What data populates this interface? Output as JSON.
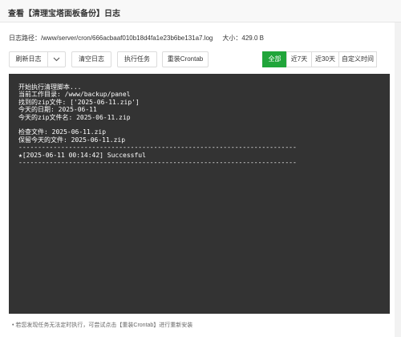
{
  "window": {
    "title": "查看【清理宝塔面板备份】日志"
  },
  "pathline": {
    "label": "日志路径：",
    "path": "/www/server/cron/666acbaaf010b18d4fa1e23b6be131a7.log",
    "size_label": "大小：",
    "size": "429.0 B"
  },
  "toolbar": {
    "refresh_label": "刷新日志",
    "clear_label": "清空日志",
    "run_label": "执行任务",
    "reinstall_label": "重装Crontab",
    "filters": [
      {
        "label": "全部",
        "active": true
      },
      {
        "label": "近7天",
        "active": false
      },
      {
        "label": "近30天",
        "active": false
      },
      {
        "label": "自定义时间",
        "active": false
      }
    ]
  },
  "log_lines": [
    "开始执行清理脚本...",
    "当前工作目录: /www/backup/panel",
    "找到的zip文件: ['2025-06-11.zip']",
    "今天的日期: 2025-06-11",
    "今天的zip文件名: 2025-06-11.zip",
    "",
    "检查文件: 2025-06-11.zip",
    "保留今天的文件: 2025-06-11.zip",
    "------------------------------------------------------------------------",
    "★[2025-06-11 00:14:42] Successful",
    "------------------------------------------------------------------------"
  ],
  "footnote": "•  若您发现任务无法定时执行，可尝试点击【重装Crontab】进行重新安装",
  "colors": {
    "accent": "#20a53a",
    "terminal_bg": "#333333",
    "terminal_fg": "#ffffff"
  }
}
